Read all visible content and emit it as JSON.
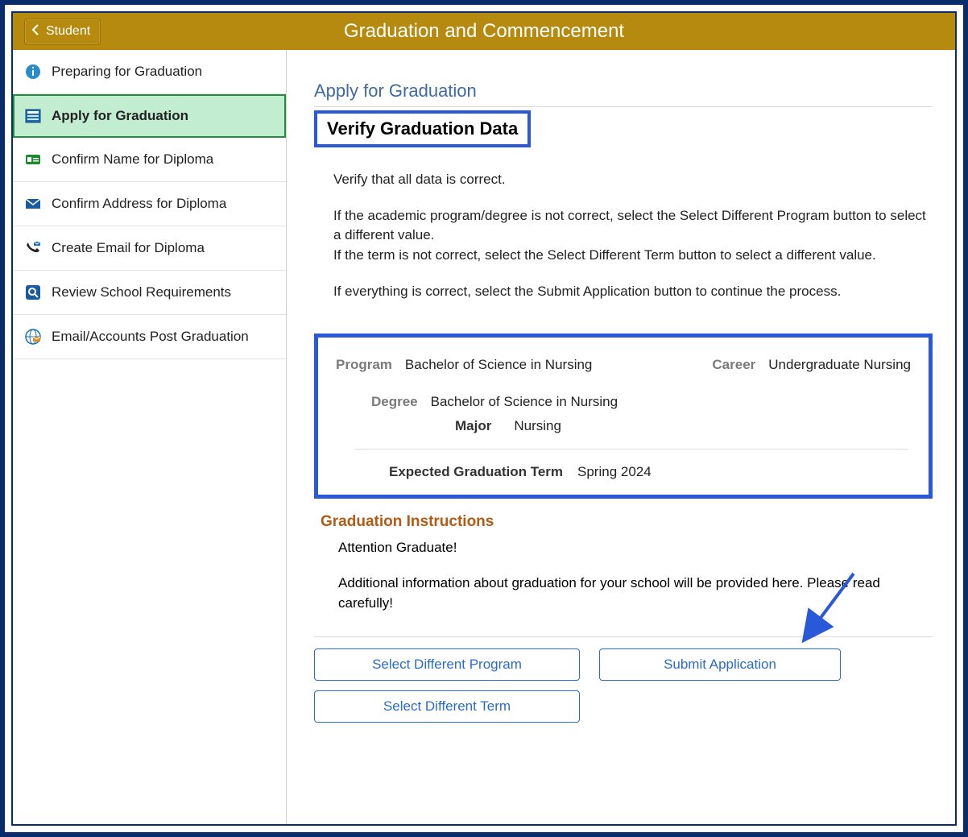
{
  "header": {
    "back_label": "Student",
    "title": "Graduation and Commencement"
  },
  "sidebar": {
    "items": [
      {
        "label": "Preparing for Graduation",
        "icon": "info-icon",
        "active": false
      },
      {
        "label": "Apply for Graduation",
        "icon": "form-icon",
        "active": true
      },
      {
        "label": "Confirm Name for Diploma",
        "icon": "id-card-icon",
        "active": false
      },
      {
        "label": "Confirm Address for Diploma",
        "icon": "mail-icon",
        "active": false
      },
      {
        "label": "Create Email for Diploma",
        "icon": "phone-mail-icon",
        "active": false
      },
      {
        "label": "Review School Requirements",
        "icon": "search-icon",
        "active": false
      },
      {
        "label": "Email/Accounts Post Graduation",
        "icon": "globe-mail-icon",
        "active": false
      }
    ]
  },
  "main": {
    "subtitle": "Apply for Graduation",
    "section_heading": "Verify Graduation Data",
    "instructions": {
      "line1": "Verify that all data is correct.",
      "line2a": "If the academic program/degree is not correct, select the Select Different Program button to select a different value.",
      "line2b": "If the term is not correct, select the Select Different Term button to select a different value.",
      "line3": "If everything is correct, select the Submit Application button to continue the process."
    },
    "data": {
      "program_label": "Program",
      "program_value": "Bachelor of Science in Nursing",
      "career_label": "Career",
      "career_value": "Undergraduate Nursing",
      "degree_label": "Degree",
      "degree_value": "Bachelor of Science in Nursing",
      "major_label": "Major",
      "major_value": "Nursing",
      "term_label": "Expected Graduation Term",
      "term_value": "Spring 2024"
    },
    "grad_instructions": {
      "heading": "Graduation Instructions",
      "line1": "Attention Graduate!",
      "line2": "Additional information about graduation for your school will be provided here. Please read carefully!"
    },
    "buttons": {
      "select_program": "Select Different Program",
      "submit": "Submit Application",
      "select_term": "Select Different Term"
    }
  }
}
